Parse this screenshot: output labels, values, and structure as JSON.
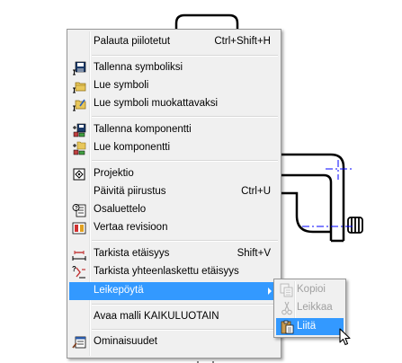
{
  "menu": {
    "items": [
      {
        "label": "Palauta piilotetut",
        "shortcut": "Ctrl+Shift+H",
        "icon": "none"
      },
      {
        "label": "Tallenna symboliksi",
        "icon": "save-symbol-icon"
      },
      {
        "label": "Lue symboli",
        "icon": "read-symbol-icon"
      },
      {
        "label": "Lue symboli muokattavaksi",
        "icon": "read-symbol-editable-icon"
      },
      {
        "label": "Tallenna komponentti",
        "icon": "save-component-icon"
      },
      {
        "label": "Lue komponentti",
        "icon": "read-component-icon"
      },
      {
        "label": "Projektio",
        "icon": "projection-icon"
      },
      {
        "label": "Päivitä piirustus",
        "shortcut": "Ctrl+U",
        "icon": "none"
      },
      {
        "label": "Osaluettelo",
        "icon": "parts-list-icon"
      },
      {
        "label": "Vertaa revisioon",
        "icon": "compare-revision-icon"
      },
      {
        "label": "Tarkista etäisyys",
        "shortcut": "Shift+V",
        "icon": "check-distance-icon"
      },
      {
        "label": "Tarkista yhteenlaskettu etäisyys",
        "icon": "check-cumulative-distance-icon"
      },
      {
        "label": "Leikepöytä",
        "icon": "none",
        "has_submenu": true,
        "highlighted": true
      },
      {
        "label": "Avaa malli KAIKULUOTAIN",
        "icon": "none"
      },
      {
        "label": "Ominaisuudet",
        "icon": "properties-icon"
      }
    ]
  },
  "submenu": {
    "items": [
      {
        "label": "Kopioi",
        "enabled": false,
        "icon": "copy-icon"
      },
      {
        "label": "Leikkaa",
        "enabled": false,
        "icon": "cut-icon"
      },
      {
        "label": "Liitä",
        "enabled": true,
        "highlighted": true,
        "icon": "paste-icon"
      }
    ]
  },
  "colors": {
    "highlight": "#3399ff",
    "menu_bg": "#f0f0f0",
    "drawing_line": "#000000",
    "center_line": "#0000ff"
  }
}
